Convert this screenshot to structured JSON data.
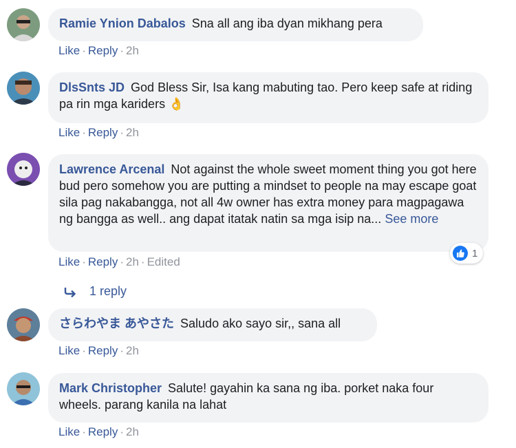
{
  "comments": [
    {
      "author": "Ramie Ynion Dabalos",
      "text": "Sna all ang iba dyan mikhang pera",
      "actions": {
        "like": "Like",
        "reply": "Reply",
        "time": "2h"
      }
    },
    {
      "author": "DlsSnts JD",
      "text": "God Bless Sir, Isa kang mabuting tao. Pero keep safe at riding pa rin mga kariders",
      "emoji": "👌",
      "actions": {
        "like": "Like",
        "reply": "Reply",
        "time": "2h"
      }
    },
    {
      "author": "Lawrence Arcenal",
      "text": "Not against the whole sweet moment thing you got here bud pero somehow you are putting a mindset to people na may escape goat sila pag nakabangga, not all 4w owner has extra money para magpagawa ng bangga as well.. ang dapat itatak natin sa mga isip na...",
      "see_more": "See more",
      "reaction_count": "1",
      "actions": {
        "like": "Like",
        "reply": "Reply",
        "time": "2h",
        "edited": "Edited"
      },
      "replies_label": "1 reply"
    },
    {
      "author": "さらわやま あやさた",
      "text": "Saludo ako sayo sir,, sana all",
      "actions": {
        "like": "Like",
        "reply": "Reply",
        "time": "2h"
      }
    },
    {
      "author": "Mark Christopher",
      "text": "Salute! gayahin ka sana ng iba. porket naka four wheels. parang kanila na lahat",
      "actions": {
        "like": "Like",
        "reply": "Reply",
        "time": "2h"
      }
    }
  ],
  "icons": {
    "reaction": "like-thumb-icon",
    "reply_arrow": "reply-arrow-icon",
    "emoji": "ok-hand-emoji"
  },
  "colors": {
    "author": "#385898",
    "bubble": "#f2f3f5",
    "meta": "#90949c",
    "like_badge": "#1877f2"
  }
}
